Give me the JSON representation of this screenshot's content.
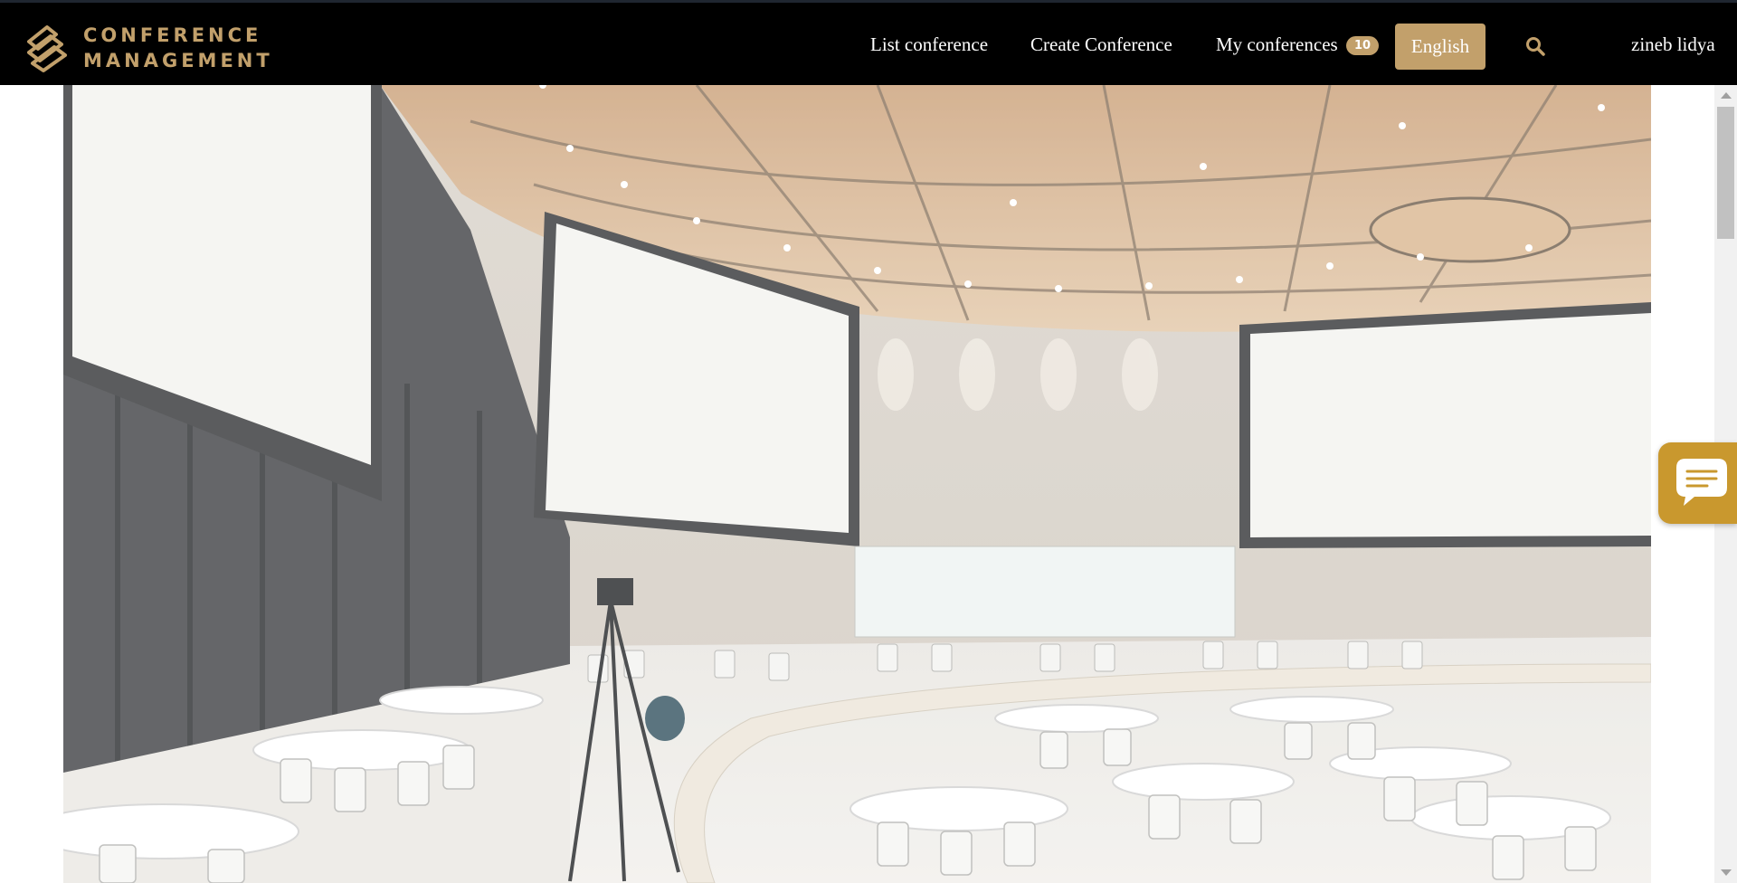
{
  "brand": {
    "line1": "CONFERENCE",
    "line2": "MANAGEMENT",
    "logo_icon": "conference-logo-icon"
  },
  "nav": {
    "list_conference": "List conference",
    "create_conference": "Create Conference",
    "my_conferences": "My conferences",
    "my_conferences_count": "10",
    "language": "English",
    "search_icon": "search-icon",
    "user_name": "zineb lidya"
  },
  "hero": {
    "image_description_icon": "conference-hall-image"
  },
  "chat": {
    "icon": "chat-bubble-icon"
  },
  "colors": {
    "navbar_bg": "#000000",
    "accent_gold": "#c2a06b",
    "chat_gold": "#c9982e"
  }
}
